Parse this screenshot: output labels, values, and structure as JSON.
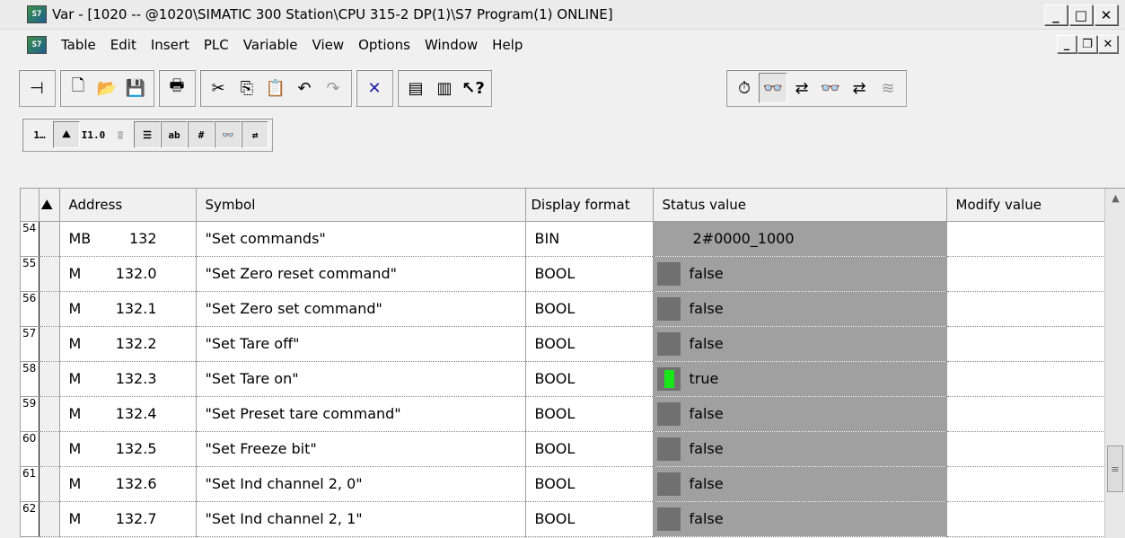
{
  "window": {
    "title": "Var - [1020 -- @1020\\SIMATIC 300 Station\\CPU 315-2 DP(1)\\S7 Program(1)  ONLINE]",
    "app_icon_text": "S7"
  },
  "menu": [
    "Table",
    "Edit",
    "Insert",
    "PLC",
    "Variable",
    "View",
    "Options",
    "Window",
    "Help"
  ],
  "toolbar": {
    "io_label": "I1.0",
    "ab_label": "ab"
  },
  "table": {
    "headers": {
      "address": "Address",
      "symbol": "Symbol",
      "display_format": "Display format",
      "status_value": "Status value",
      "modify_value": "Modify value"
    },
    "rows": [
      {
        "num": "54",
        "op": "MB",
        "addr": "132",
        "symbol": "\"Set commands\"",
        "format": "BIN",
        "status": "2#0000_1000",
        "led": "none"
      },
      {
        "num": "55",
        "op": "M",
        "addr": "132.0",
        "symbol": "\"Set Zero reset command\"",
        "format": "BOOL",
        "status": "false",
        "led": "off"
      },
      {
        "num": "56",
        "op": "M",
        "addr": "132.1",
        "symbol": "\"Set Zero set command\"",
        "format": "BOOL",
        "status": "false",
        "led": "off"
      },
      {
        "num": "57",
        "op": "M",
        "addr": "132.2",
        "symbol": "\"Set Tare off\"",
        "format": "BOOL",
        "status": "false",
        "led": "off"
      },
      {
        "num": "58",
        "op": "M",
        "addr": "132.3",
        "symbol": "\"Set Tare on\"",
        "format": "BOOL",
        "status": "true",
        "led": "on"
      },
      {
        "num": "59",
        "op": "M",
        "addr": "132.4",
        "symbol": "\"Set Preset tare command\"",
        "format": "BOOL",
        "status": "false",
        "led": "off"
      },
      {
        "num": "60",
        "op": "M",
        "addr": "132.5",
        "symbol": "\"Set Freeze bit\"",
        "format": "BOOL",
        "status": "false",
        "led": "off"
      },
      {
        "num": "61",
        "op": "M",
        "addr": "132.6",
        "symbol": "\"Set Ind channel 2, 0\"",
        "format": "BOOL",
        "status": "false",
        "led": "off"
      },
      {
        "num": "62",
        "op": "M",
        "addr": "132.7",
        "symbol": "\"Set Ind channel 2, 1\"",
        "format": "BOOL",
        "status": "false",
        "led": "off"
      }
    ]
  },
  "colors": {
    "status_bg": "#a0a0a0",
    "led_off": "#707070",
    "led_on": "#19e619"
  }
}
